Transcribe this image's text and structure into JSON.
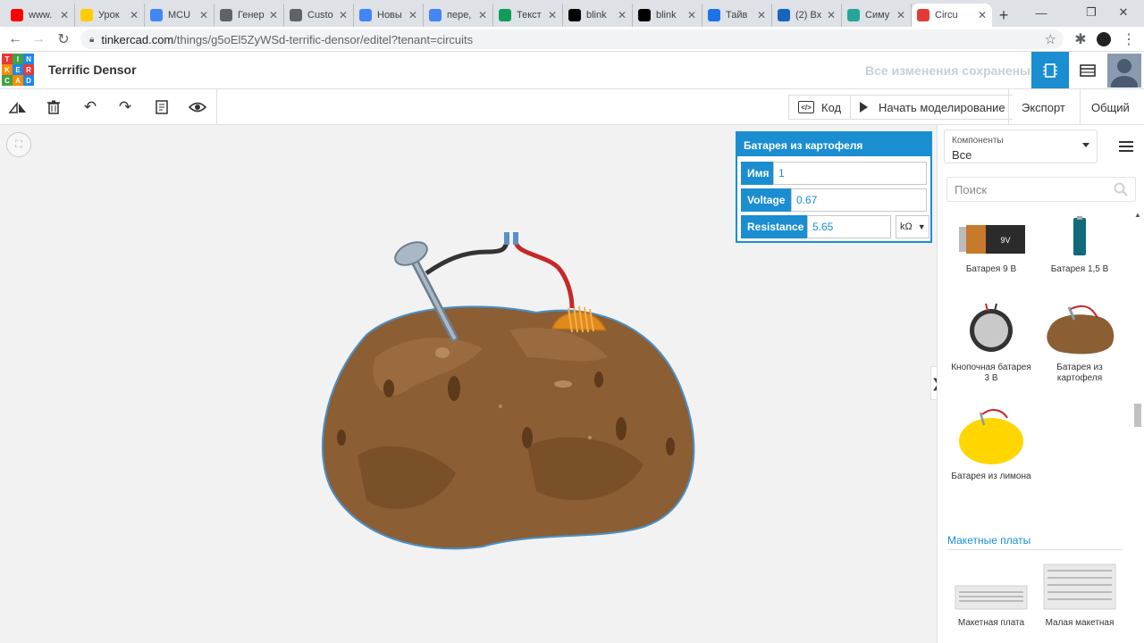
{
  "browser": {
    "tabs": [
      {
        "title": "www.",
        "favicon": "youtube-icon",
        "color": "#ff0000"
      },
      {
        "title": "Урок",
        "favicon": "diamond-icon",
        "color": "#ffcc00"
      },
      {
        "title": "MCU",
        "favicon": "docs-icon",
        "color": "#4285f4"
      },
      {
        "title": "Генер",
        "favicon": "globe-icon",
        "color": "#5f6368"
      },
      {
        "title": "Custo",
        "favicon": "globe-icon",
        "color": "#5f6368"
      },
      {
        "title": "Новы",
        "favicon": "docs-icon",
        "color": "#4285f4"
      },
      {
        "title": "пере,",
        "favicon": "google-icon",
        "color": "#4285f4"
      },
      {
        "title": "Текст",
        "favicon": "text-icon",
        "color": "#0f9d58"
      },
      {
        "title": "blink",
        "favicon": "wikipedia-icon",
        "color": "#000000"
      },
      {
        "title": "blink",
        "favicon": "wikipedia-icon",
        "color": "#000000"
      },
      {
        "title": "Тайв",
        "favicon": "at-icon",
        "color": "#1a73e8"
      },
      {
        "title": "(2) Вх",
        "favicon": "mail-icon",
        "color": "#1565c0"
      },
      {
        "title": "Симу",
        "favicon": "diamond-icon",
        "color": "#26a69a"
      },
      {
        "title": "Circu",
        "favicon": "tinkercad-icon",
        "color": "#e53935"
      }
    ],
    "new_tab": "+",
    "url_domain": "tinkercad.com",
    "url_path": "/things/g5oEl5ZyWSd-terrific-densor/editel?tenant=circuits"
  },
  "header": {
    "logo_letters": [
      "T",
      "I",
      "N",
      "K",
      "E",
      "R",
      "C",
      "A",
      "D"
    ],
    "logo_colors": [
      "#e53935",
      "#43a047",
      "#1e88e5",
      "#fb8c00",
      "#1e88e5",
      "#e53935",
      "#43a047",
      "#fb8c00",
      "#1e88e5"
    ],
    "project_name": "Terrific Densor",
    "save_status": "Все изменения сохранены",
    "accent": "#1a8ed0"
  },
  "toolbar": {
    "code_label": "Код",
    "simulate_label": "Начать моделирование",
    "export_label": "Экспорт",
    "share_label": "Общий"
  },
  "inspector": {
    "title": "Батарея из картофеля",
    "name_label": "Имя",
    "name_value": "1",
    "voltage_label": "Voltage",
    "voltage_value": "0.67",
    "resistance_label": "Resistance",
    "resistance_value": "5.65",
    "resistance_unit": "kΩ"
  },
  "panel": {
    "components_label": "Компоненты",
    "components_value": "Все",
    "search_placeholder": "Поиск",
    "items": [
      {
        "name": "Батарея 9 В",
        "icon": "battery-9v-icon"
      },
      {
        "name": "Батарея 1,5 В",
        "icon": "battery-aa-icon"
      },
      {
        "name": "Кнопочная батарея 3 В",
        "icon": "coin-cell-icon"
      },
      {
        "name": "Батарея из картофеля",
        "icon": "potato-battery-icon"
      },
      {
        "name": "Батарея из лимона",
        "icon": "lemon-battery-icon"
      }
    ],
    "section_title": "Макетные платы",
    "boards": [
      {
        "name": "Макетная плата",
        "icon": "breadboard-icon"
      },
      {
        "name": "Малая макетная",
        "icon": "small-breadboard-icon"
      }
    ],
    "battery_9v_text": "9V"
  }
}
